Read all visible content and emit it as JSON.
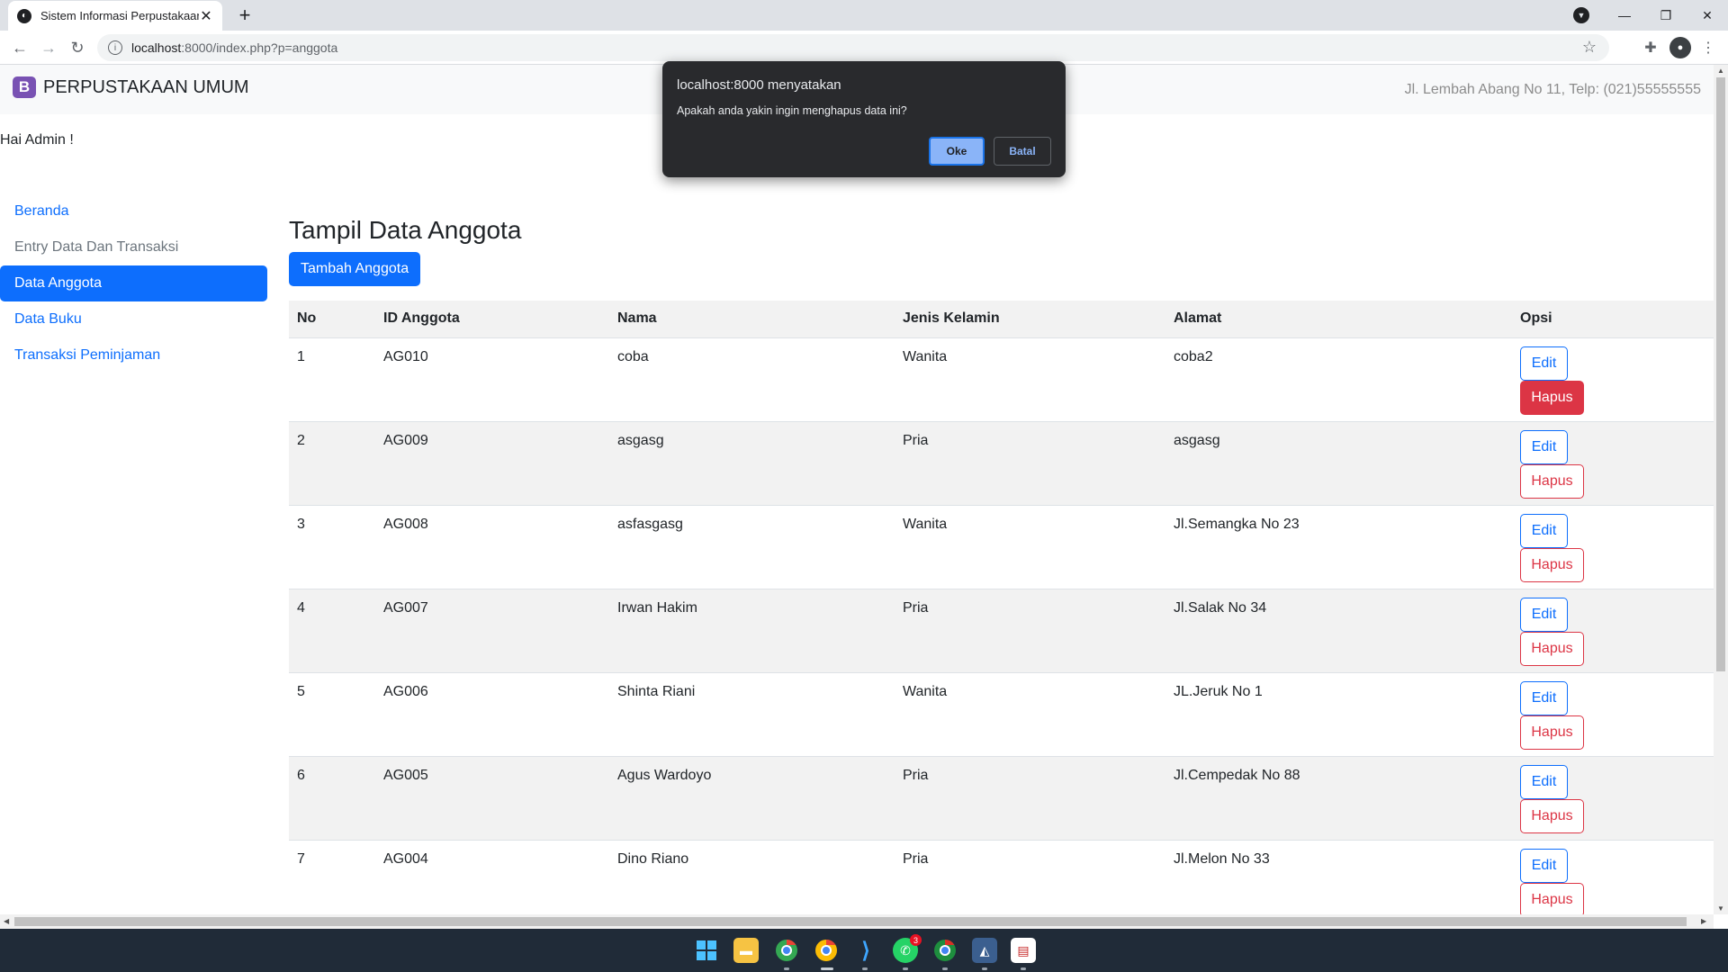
{
  "browser": {
    "tab_title": "Sistem Informasi Perpustakaan",
    "tab_close": "✕",
    "new_tab": "+",
    "url_host": "localhost",
    "url_rest": ":8000/index.php?p=anggota",
    "win_min": "—",
    "win_restore": "❐",
    "win_close": "✕"
  },
  "navbar": {
    "brand_logo": "B",
    "brand": "PERPUSTAKAAN UMUM",
    "address": "Jl. Lembah Abang No 11, Telp: (021)55555555"
  },
  "greeting": "Hai Admin !",
  "sidebar": {
    "items": [
      {
        "label": "Beranda"
      },
      {
        "label": "Entry Data Dan Transaksi"
      },
      {
        "label": "Data Anggota"
      },
      {
        "label": "Data Buku"
      },
      {
        "label": "Transaksi Peminjaman"
      }
    ]
  },
  "main": {
    "title": "Tampil Data Anggota",
    "add_button": "Tambah Anggota",
    "columns": [
      "No",
      "ID Anggota",
      "Nama",
      "Jenis Kelamin",
      "Alamat",
      "Opsi"
    ],
    "edit_label": "Edit",
    "delete_label": "Hapus",
    "rows": [
      [
        "1",
        "AG010",
        "coba",
        "Wanita",
        "coba2"
      ],
      [
        "2",
        "AG009",
        "asgasg",
        "Pria",
        "asgasg"
      ],
      [
        "3",
        "AG008",
        "asfasgasg",
        "Wanita",
        "Jl.Semangka No 23"
      ],
      [
        "4",
        "AG007",
        "Irwan Hakim",
        "Pria",
        "Jl.Salak No 34"
      ],
      [
        "5",
        "AG006",
        "Shinta Riani",
        "Wanita",
        "JL.Jeruk No 1"
      ],
      [
        "6",
        "AG005",
        "Agus Wardoyo",
        "Pria",
        "Jl.Cempedak No 88"
      ],
      [
        "7",
        "AG004",
        "Dino Riano",
        "Pria",
        "Jl.Melon No 33"
      ]
    ]
  },
  "dialog": {
    "title": "localhost:8000 menyatakan",
    "message": "Apakah anda yakin ingin menghapus data ini?",
    "ok": "Oke",
    "cancel": "Batal"
  },
  "taskbar": {
    "whatsapp_badge": "3"
  }
}
